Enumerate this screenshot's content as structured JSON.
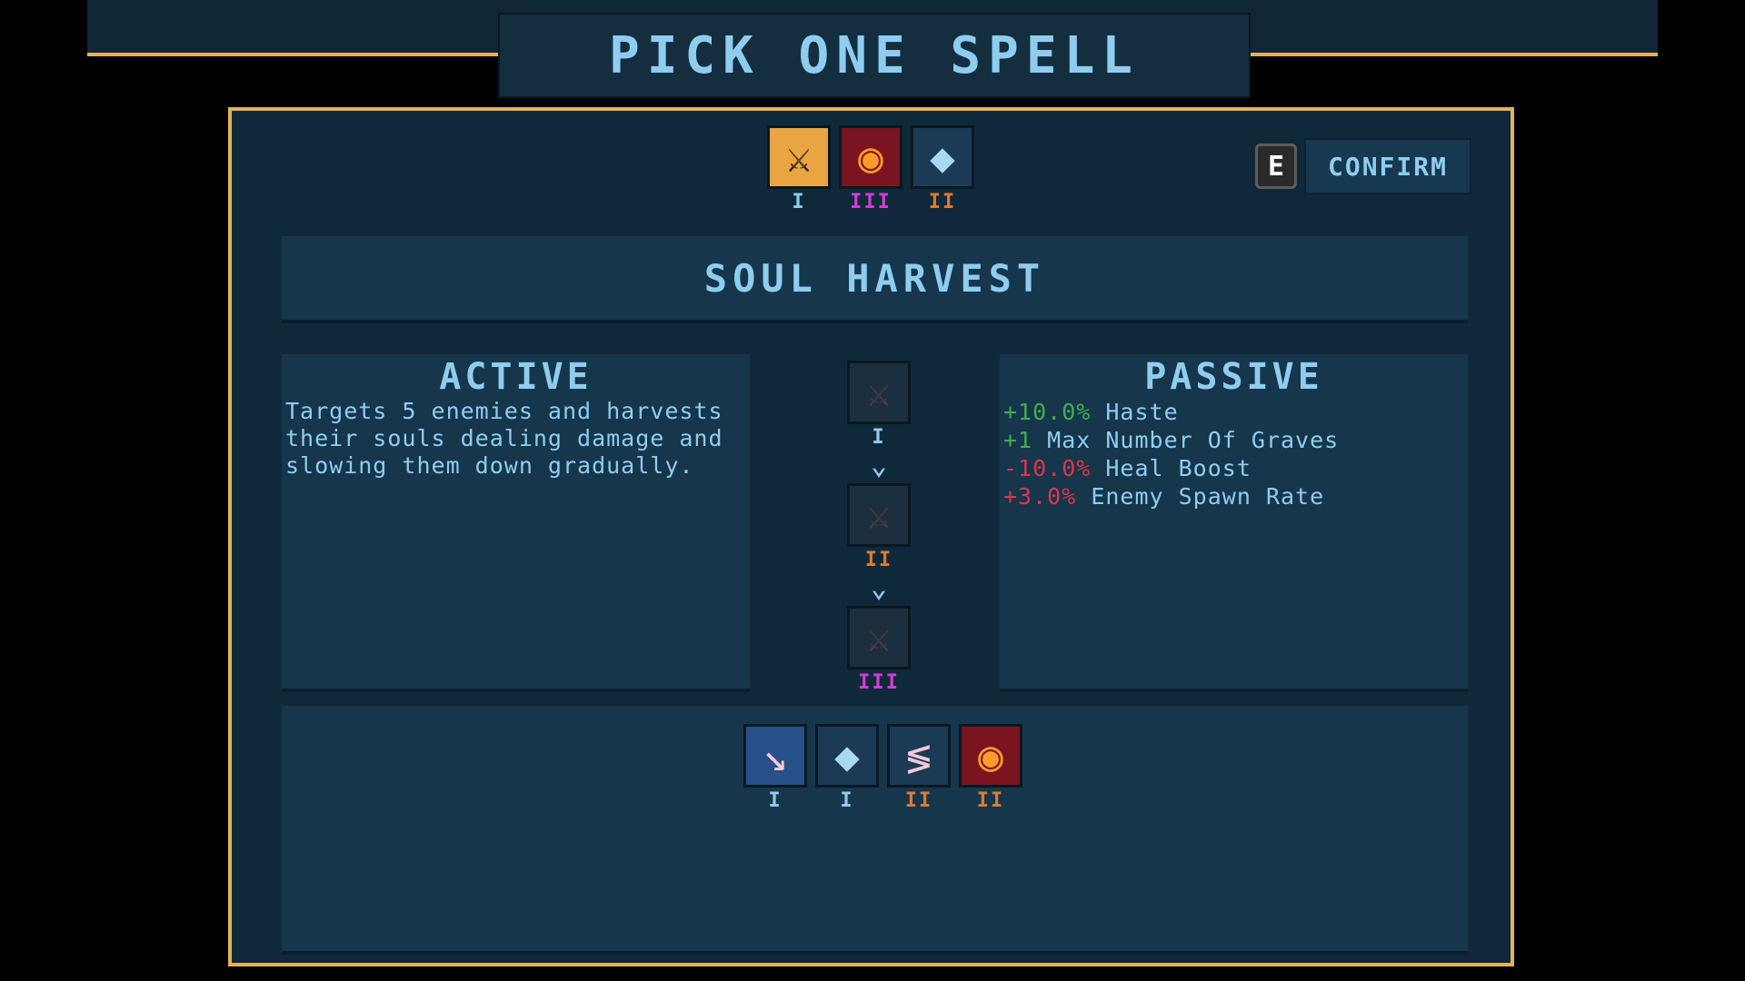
{
  "header": {
    "title": "PICK ONE SPELL"
  },
  "choices": [
    {
      "icon": "reaper-icon",
      "glyph": "⚔",
      "tier": "I",
      "tier_color": "#8fcdf0",
      "selected": true
    },
    {
      "icon": "fire-ring-icon",
      "glyph": "◉",
      "tier": "III",
      "tier_color": "#d03ed6",
      "selected": false
    },
    {
      "icon": "crystal-icon",
      "glyph": "◆",
      "tier": "II",
      "tier_color": "#e07a32",
      "selected": false
    }
  ],
  "confirm": {
    "key": "E",
    "label": "CONFIRM"
  },
  "spell": {
    "name": "SOUL HARVEST"
  },
  "active": {
    "title": "ACTIVE",
    "description": "Targets 5 enemies and harvests their souls dealing damage and slowing them down gradually."
  },
  "passive": {
    "title": "PASSIVE",
    "stats": [
      {
        "value": "+10.0%",
        "label": "Haste",
        "positive": true
      },
      {
        "value": "+1",
        "label": "Max Number Of Graves",
        "positive": true
      },
      {
        "value": "-10.0%",
        "label": "Heal Boost",
        "positive": false
      },
      {
        "value": "+3.0%",
        "label": "Enemy Spawn Rate",
        "positive": false
      }
    ]
  },
  "upgrade_path": [
    {
      "tier": "I",
      "tier_color": "#8fcdf0"
    },
    {
      "tier": "II",
      "tier_color": "#e07a32"
    },
    {
      "tier": "III",
      "tier_color": "#d03ed6"
    }
  ],
  "owned": [
    {
      "icon": "arrow-strike-icon",
      "glyph": "↘",
      "tier": "I",
      "tier_color": "#8fcdf0"
    },
    {
      "icon": "crystal-icon",
      "glyph": "◆",
      "tier": "I",
      "tier_color": "#8fcdf0"
    },
    {
      "icon": "slash-icon",
      "glyph": "≶",
      "tier": "II",
      "tier_color": "#e07a32"
    },
    {
      "icon": "fire-ring-icon",
      "glyph": "◉",
      "tier": "II",
      "tier_color": "#e07a32"
    }
  ],
  "colors": {
    "accent_gold": "#e6b15a",
    "text_blue": "#8fcdf0",
    "positive_green": "#3fae52",
    "negative_red": "#e0344a"
  }
}
